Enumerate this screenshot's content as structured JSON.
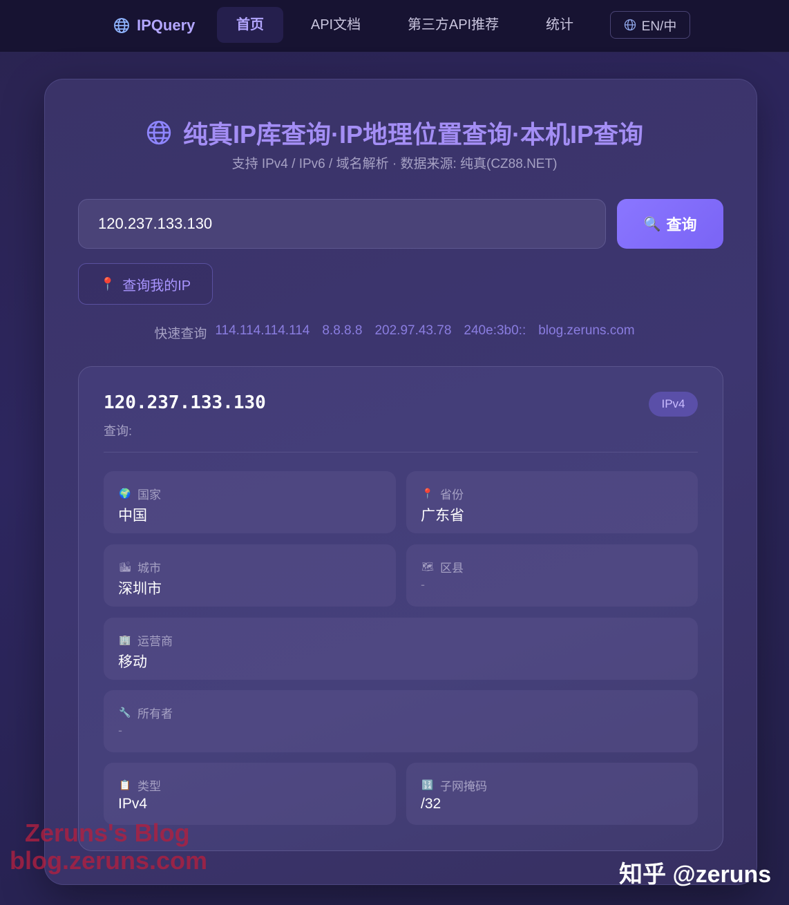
{
  "nav": {
    "logo": "IPQuery",
    "items": [
      {
        "label": "首页"
      },
      {
        "label": "API文档"
      },
      {
        "label": "第三方API推荐"
      },
      {
        "label": "统计"
      }
    ],
    "lang": "EN/中"
  },
  "hero": {
    "title": "纯真IP库查询·IP地理位置查询·本机IP查询",
    "subtitle": "支持 IPv4 / IPv6 / 域名解析 · 数据来源: 纯真(CZ88.NET)"
  },
  "search": {
    "value": "120.237.133.130",
    "button": "查询",
    "my_ip": "查询我的IP"
  },
  "quick": {
    "label": "快速查询",
    "links": [
      "114.114.114.114",
      "8.8.8.8",
      "202.97.43.78",
      "240e:3b0::",
      "blog.zeruns.com"
    ]
  },
  "result": {
    "ip": "120.237.133.130",
    "sub": "查询:",
    "badge": "IPv4",
    "fields": {
      "country": {
        "icon": "globe-icon",
        "label": "国家",
        "value": "中国"
      },
      "province": {
        "icon": "pin-icon",
        "label": "省份",
        "value": "广东省"
      },
      "city": {
        "icon": "city-icon",
        "label": "城市",
        "value": "深圳市"
      },
      "district": {
        "icon": "map-icon",
        "label": "区县",
        "value": "-"
      },
      "isp": {
        "icon": "building-icon",
        "label": "运营商",
        "value": "移动"
      },
      "owner": {
        "icon": "wrench-icon",
        "label": "所有者",
        "value": "-"
      },
      "type": {
        "icon": "clipboard-icon",
        "label": "类型",
        "value": "IPv4"
      },
      "mask": {
        "icon": "numbers-icon",
        "label": "子网掩码",
        "value": "/32"
      }
    }
  },
  "watermark": {
    "blog_line1": "Zeruns's Blog",
    "blog_line2": "blog.zeruns.com",
    "zhihu": "知乎 @zeruns"
  },
  "colors": {
    "accent": "#a48ef5",
    "button": "#8a76ff",
    "background": "#2a2350"
  }
}
